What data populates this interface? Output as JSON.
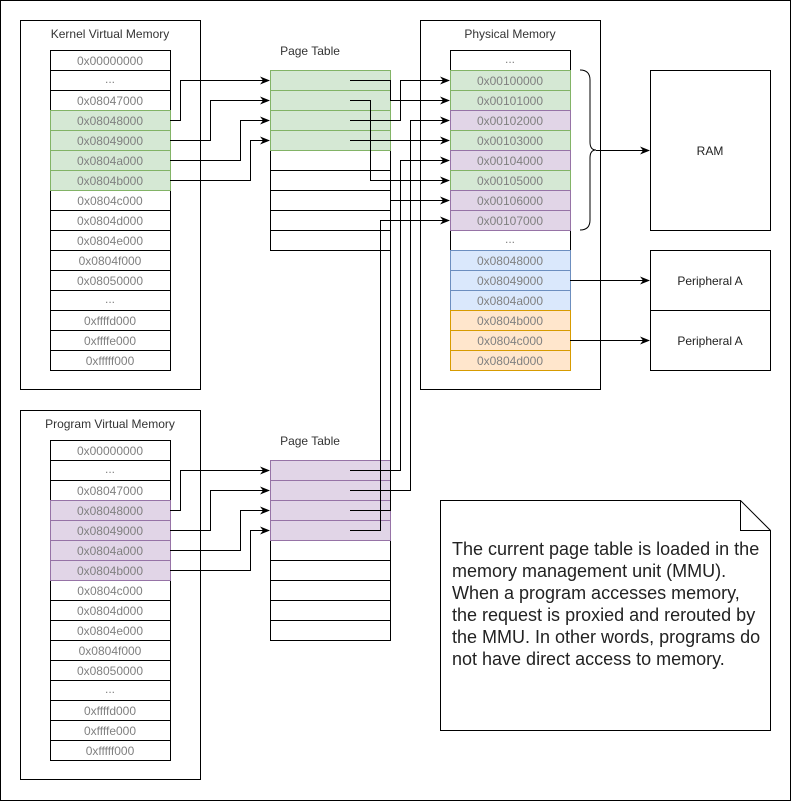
{
  "kernel_virtual_memory": {
    "title": "Kernel Virtual Memory",
    "rows": [
      {
        "label": "0x00000000",
        "state": "plain"
      },
      {
        "label": "...",
        "state": "plain"
      },
      {
        "label": "0x08047000",
        "state": "plain"
      },
      {
        "label": "0x08048000",
        "state": "kernel"
      },
      {
        "label": "0x08049000",
        "state": "kernel"
      },
      {
        "label": "0x0804a000",
        "state": "kernel"
      },
      {
        "label": "0x0804b000",
        "state": "kernel"
      },
      {
        "label": "0x0804c000",
        "state": "plain"
      },
      {
        "label": "0x0804d000",
        "state": "plain"
      },
      {
        "label": "0x0804e000",
        "state": "plain"
      },
      {
        "label": "0x0804f000",
        "state": "plain"
      },
      {
        "label": "0x08050000",
        "state": "plain"
      },
      {
        "label": "...",
        "state": "plain"
      },
      {
        "label": "0xffffd000",
        "state": "plain"
      },
      {
        "label": "0xffffe000",
        "state": "plain"
      },
      {
        "label": "0xfffff000",
        "state": "plain"
      }
    ]
  },
  "program_virtual_memory": {
    "title": "Program Virtual Memory",
    "rows": [
      {
        "label": "0x00000000",
        "state": "plain"
      },
      {
        "label": "...",
        "state": "plain"
      },
      {
        "label": "0x08047000",
        "state": "plain"
      },
      {
        "label": "0x08048000",
        "state": "program"
      },
      {
        "label": "0x08049000",
        "state": "program"
      },
      {
        "label": "0x0804a000",
        "state": "program"
      },
      {
        "label": "0x0804b000",
        "state": "program"
      },
      {
        "label": "0x0804c000",
        "state": "plain"
      },
      {
        "label": "0x0804d000",
        "state": "plain"
      },
      {
        "label": "0x0804e000",
        "state": "plain"
      },
      {
        "label": "0x0804f000",
        "state": "plain"
      },
      {
        "label": "0x08050000",
        "state": "plain"
      },
      {
        "label": "...",
        "state": "plain"
      },
      {
        "label": "0xffffd000",
        "state": "plain"
      },
      {
        "label": "0xffffe000",
        "state": "plain"
      },
      {
        "label": "0xfffff000",
        "state": "plain"
      }
    ]
  },
  "kernel_page_table": {
    "title": "Page Table",
    "rows": [
      "kernel",
      "kernel",
      "kernel",
      "kernel",
      "plain",
      "plain",
      "plain",
      "plain",
      "plain"
    ]
  },
  "program_page_table": {
    "title": "Page Table",
    "rows": [
      "program",
      "program",
      "program",
      "program",
      "plain",
      "plain",
      "plain",
      "plain",
      "plain"
    ]
  },
  "physical_memory": {
    "title": "Physical Memory",
    "rows": [
      {
        "label": "...",
        "state": "plain"
      },
      {
        "label": "0x00100000",
        "state": "kernel"
      },
      {
        "label": "0x00101000",
        "state": "kernel"
      },
      {
        "label": "0x00102000",
        "state": "program"
      },
      {
        "label": "0x00103000",
        "state": "kernel"
      },
      {
        "label": "0x00104000",
        "state": "program"
      },
      {
        "label": "0x00105000",
        "state": "kernel"
      },
      {
        "label": "0x00106000",
        "state": "program"
      },
      {
        "label": "0x00107000",
        "state": "program"
      },
      {
        "label": "...",
        "state": "plain"
      },
      {
        "label": "0x08048000",
        "state": "peripheral_a"
      },
      {
        "label": "0x08049000",
        "state": "peripheral_a"
      },
      {
        "label": "0x0804a000",
        "state": "peripheral_a"
      },
      {
        "label": "0x0804b000",
        "state": "peripheral_b"
      },
      {
        "label": "0x0804c000",
        "state": "peripheral_b"
      },
      {
        "label": "0x0804d000",
        "state": "peripheral_b"
      }
    ]
  },
  "devices": {
    "ram": "RAM",
    "peripheral_1": "Peripheral A",
    "peripheral_2": "Peripheral A"
  },
  "mappings": {
    "kernel_virtual_to_page_table": [
      [
        3,
        0
      ],
      [
        4,
        1
      ],
      [
        5,
        2
      ],
      [
        6,
        3
      ]
    ],
    "program_virtual_to_page_table": [
      [
        3,
        0
      ],
      [
        4,
        1
      ],
      [
        5,
        2
      ],
      [
        6,
        3
      ]
    ],
    "kernel_page_table_to_physical": [
      [
        0,
        2
      ],
      [
        1,
        6
      ],
      [
        2,
        1
      ],
      [
        3,
        4
      ]
    ],
    "program_page_table_to_physical": [
      [
        0,
        5
      ],
      [
        1,
        3
      ],
      [
        2,
        7
      ],
      [
        3,
        8
      ]
    ]
  },
  "note": {
    "text": "The current page table is loaded in the memory management unit (MMU). When a program accesses memory, the request is proxied and rerouted by the MMU. In other words, programs do not have direct access to memory."
  },
  "colors": {
    "kernel_fill": "#d5e8d4",
    "kernel_stroke": "#82b366",
    "program_fill": "#e1d5e7",
    "program_stroke": "#9673a6",
    "peripheral_a_fill": "#dae8fc",
    "peripheral_a_stroke": "#6c8ebf",
    "peripheral_b_fill": "#ffe6cc",
    "peripheral_b_stroke": "#d79b00",
    "plain_fill": "#ffffff",
    "plain_stroke": "#000000"
  }
}
